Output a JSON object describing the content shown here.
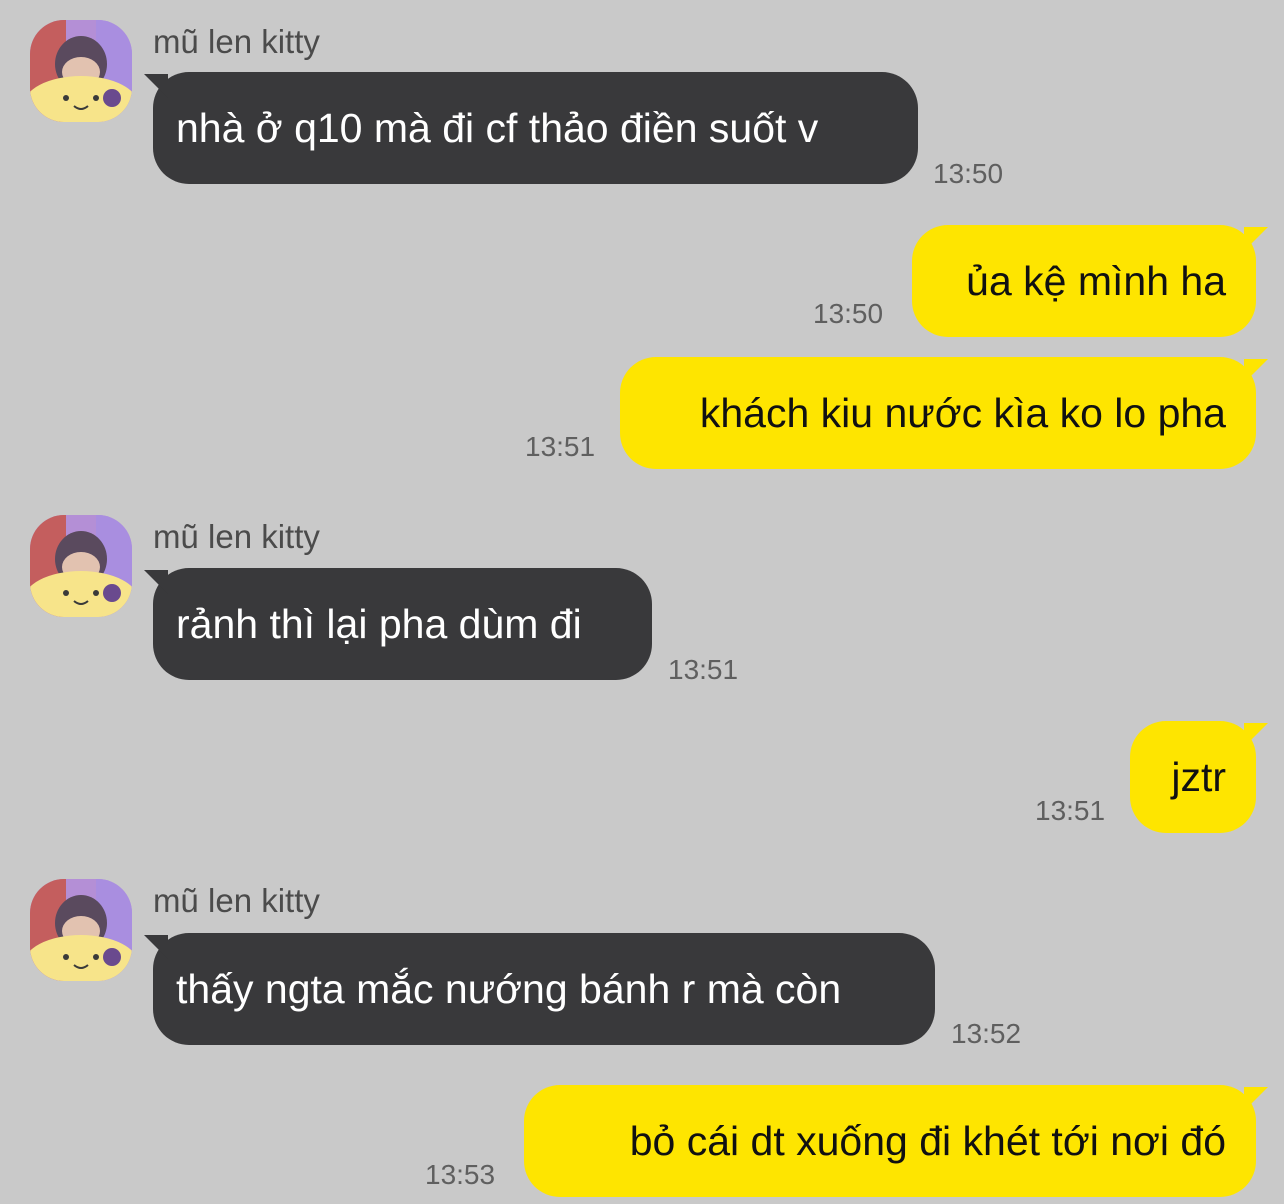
{
  "messages": [
    {
      "direction": "incoming",
      "sender": "mũ len kitty",
      "text": "nhà ở q10 mà đi cf thảo điền suốt v",
      "time": "13:50"
    },
    {
      "direction": "outgoing",
      "text": "ủa kệ mình ha",
      "time": "13:50"
    },
    {
      "direction": "outgoing",
      "text": "khách kiu nước kìa ko lo pha",
      "time": "13:51"
    },
    {
      "direction": "incoming",
      "sender": "mũ len kitty",
      "text": "rảnh thì lại pha dùm đi",
      "time": "13:51"
    },
    {
      "direction": "outgoing",
      "text": "jztr",
      "time": "13:51"
    },
    {
      "direction": "incoming",
      "sender": "mũ len kitty",
      "text": "thấy ngta mắc nướng bánh r mà còn",
      "time": "13:52"
    },
    {
      "direction": "outgoing",
      "text": "bỏ cái dt xuống đi khét tới nơi đó",
      "time": "13:53"
    }
  ],
  "colors": {
    "background": "#c9c9c9",
    "incoming_bubble": "#39393b",
    "outgoing_bubble": "#fee500"
  }
}
